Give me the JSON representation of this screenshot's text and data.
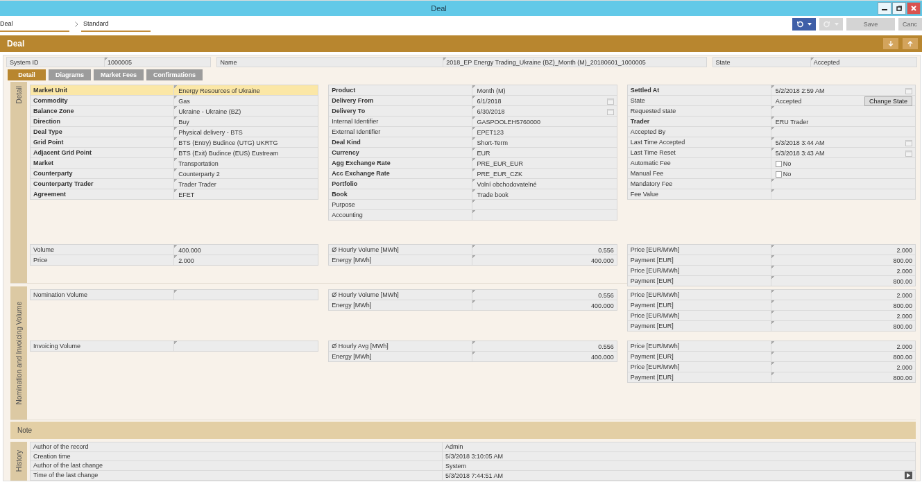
{
  "window": {
    "title": "Deal",
    "controls": [
      {
        "kind": "minimize"
      },
      {
        "kind": "restore"
      },
      {
        "kind": "close"
      }
    ]
  },
  "breadcrumb": [
    {
      "label": "Deal"
    },
    {
      "label": "Standard"
    }
  ],
  "toolbar": [
    {
      "kind": "undo",
      "disabled": false
    },
    {
      "kind": "redo",
      "disabled": true
    },
    {
      "kind": "text",
      "label": "Save",
      "disabled": true
    },
    {
      "kind": "text",
      "label": "Canc",
      "disabled": true
    }
  ],
  "header": {
    "title": "Deal",
    "buttons": [
      {
        "kind": "down"
      },
      {
        "kind": "up"
      }
    ]
  },
  "info": [
    {
      "label": "System ID",
      "value": "1000005"
    },
    {
      "label": "Name",
      "value": "2018_EP Energy Trading_Ukraine (BZ)_Month (M)_20180601_1000005"
    },
    {
      "label": "State",
      "value": "Accepted"
    }
  ],
  "tabs": [
    {
      "label": "Detail",
      "selected": true
    },
    {
      "label": "Diagrams",
      "selected": false
    },
    {
      "label": "Market Fees",
      "selected": false
    },
    {
      "label": "Confirmations",
      "selected": false
    }
  ],
  "detail": {
    "title": "Detail",
    "columns": [
      [
        {
          "label": "Market Unit",
          "value": "Energy Resources of Ukraine",
          "kind": "text",
          "bold": true,
          "selected": true
        },
        {
          "label": "Commodity",
          "value": "Gas",
          "kind": "text",
          "bold": true,
          "selected": false
        },
        {
          "label": "Balance Zone",
          "value": "Ukraine - Ukraine (BZ)",
          "kind": "text",
          "bold": true,
          "selected": false
        },
        {
          "label": "Direction",
          "value": "Buy",
          "kind": "text",
          "bold": true,
          "selected": false
        },
        {
          "label": "Deal Type",
          "value": "Physical delivery - BTS",
          "kind": "text",
          "bold": true,
          "selected": false
        },
        {
          "label": "Grid Point",
          "value": "BTS (Entry) Budince (UTG) UKRTG",
          "kind": "text",
          "bold": true,
          "selected": false
        },
        {
          "label": "Adjacent Grid Point",
          "value": "BTS (Exit) Budince (EUS) Eustream",
          "kind": "text",
          "bold": true,
          "selected": false
        },
        {
          "label": "Market",
          "value": "Transportation",
          "kind": "text",
          "bold": true,
          "selected": false
        },
        {
          "label": "Counterparty",
          "value": "Counterparty 2",
          "kind": "text",
          "bold": true,
          "selected": false
        },
        {
          "label": "Counterparty Trader",
          "value": "Trader Trader",
          "kind": "text",
          "bold": true,
          "selected": false
        },
        {
          "label": "Agreement",
          "value": "EFET",
          "kind": "text",
          "bold": true,
          "selected": false
        }
      ],
      [
        {
          "label": "Product",
          "value": "Month (M)",
          "kind": "text",
          "bold": true,
          "selected": false
        },
        {
          "label": "Delivery From",
          "value": "6/1/2018",
          "kind": "date",
          "bold": true,
          "selected": false
        },
        {
          "label": "Delivery To",
          "value": "6/30/2018",
          "kind": "date",
          "bold": true,
          "selected": false
        },
        {
          "label": "Internal Identifier",
          "value": "GASPOOLEH5760000",
          "kind": "text",
          "bold": false,
          "selected": false
        },
        {
          "label": "External Identifier",
          "value": "EPET123",
          "kind": "text",
          "bold": false,
          "selected": false
        },
        {
          "label": "Deal Kind",
          "value": "Short-Term",
          "kind": "text",
          "bold": true,
          "selected": false
        },
        {
          "label": "Currency",
          "value": "EUR",
          "kind": "text",
          "bold": true,
          "selected": false
        },
        {
          "label": "Agg Exchange Rate",
          "value": "PRE_EUR_EUR",
          "kind": "text",
          "bold": true,
          "selected": false
        },
        {
          "label": "Acc Exchange Rate",
          "value": "PRE_EUR_CZK",
          "kind": "text",
          "bold": true,
          "selected": false
        },
        {
          "label": "Portfolio",
          "value": "Volní obchodovatelné",
          "kind": "text",
          "bold": true,
          "selected": false
        },
        {
          "label": "Book",
          "value": "Trade book",
          "kind": "text",
          "bold": true,
          "selected": false
        },
        {
          "label": "Purpose",
          "kind": "text",
          "bold": false,
          "selected": false
        },
        {
          "label": "Accounting",
          "kind": "text",
          "bold": false,
          "selected": false
        }
      ],
      [
        {
          "label": "Settled At",
          "value": "5/2/2018 2:59 AM",
          "kind": "date",
          "bold": true,
          "selected": false
        },
        {
          "label": "State",
          "value": "Accepted",
          "button": "Change State",
          "kind": "state",
          "bold": false,
          "selected": false
        },
        {
          "label": "Requested state",
          "kind": "text",
          "bold": false,
          "selected": false
        },
        {
          "label": "Trader",
          "value": "ERU Trader",
          "kind": "text",
          "bold": true,
          "selected": false
        },
        {
          "label": "Accepted By",
          "kind": "text",
          "bold": false,
          "selected": false
        },
        {
          "label": "Last Time Accepted",
          "value": "5/3/2018 3:44 AM",
          "kind": "date",
          "bold": false,
          "selected": false
        },
        {
          "label": "Last Time Reset",
          "value": "5/3/2018 3:43 AM",
          "kind": "date",
          "bold": false,
          "selected": false
        },
        {
          "label": "Automatic Fee",
          "value": "No",
          "kind": "checkbox",
          "checked": false,
          "bold": false,
          "selected": false
        },
        {
          "label": "Manual Fee",
          "value": "No",
          "kind": "checkbox",
          "checked": false,
          "bold": false,
          "selected": false
        },
        {
          "label": "Mandatory Fee",
          "kind": "text",
          "bold": false,
          "selected": false
        },
        {
          "label": "Fee Value",
          "kind": "text",
          "bold": false,
          "selected": false
        }
      ]
    ],
    "amounts": [
      [
        {
          "label": "Volume",
          "value": "400.000",
          "kind": "text"
        },
        {
          "label": "Price",
          "value": "2.000",
          "kind": "text"
        }
      ],
      [
        {
          "label": "Ø Hourly Volume [MWh]",
          "value": "0.556",
          "kind": "number"
        },
        {
          "label": "Energy [MWh]",
          "value": "400.000",
          "kind": "number"
        }
      ],
      [
        {
          "label": "Price [EUR/MWh]",
          "value": "2.000",
          "kind": "number"
        },
        {
          "label": "Payment [EUR]",
          "value": "800.00",
          "kind": "number"
        },
        {
          "label": "Price [EUR/MWh]",
          "value": "2.000",
          "kind": "number"
        },
        {
          "label": "Payment [EUR]",
          "value": "800.00",
          "kind": "number"
        }
      ]
    ]
  },
  "nomination": {
    "title": "Nomination and Invoicing Volume",
    "groups": [
      [
        [
          {
            "label": "Nomination Volume",
            "kind": "text"
          }
        ],
        [
          {
            "label": "Ø Hourly Volume [MWh]",
            "value": "0.556",
            "kind": "number"
          },
          {
            "label": "Energy [MWh]",
            "value": "400.000",
            "kind": "number"
          }
        ],
        [
          {
            "label": "Price [EUR/MWh]",
            "value": "2.000",
            "kind": "number"
          },
          {
            "label": "Payment [EUR]",
            "value": "800.00",
            "kind": "number"
          },
          {
            "label": "Price [EUR/MWh]",
            "value": "2.000",
            "kind": "number"
          },
          {
            "label": "Payment [EUR]",
            "value": "800.00",
            "kind": "number"
          }
        ]
      ],
      [
        [
          {
            "label": "Invoicing Volume",
            "kind": "text"
          }
        ],
        [
          {
            "label": "Ø Hourly Avg [MWh]",
            "value": "0.556",
            "kind": "number"
          },
          {
            "label": "Energy [MWh]",
            "value": "400.000",
            "kind": "number"
          }
        ],
        [
          {
            "label": "Price [EUR/MWh]",
            "value": "2.000",
            "kind": "number"
          },
          {
            "label": "Payment [EUR]",
            "value": "800.00",
            "kind": "number"
          },
          {
            "label": "Price [EUR/MWh]",
            "value": "2.000",
            "kind": "number"
          },
          {
            "label": "Payment [EUR]",
            "value": "800.00",
            "kind": "number"
          }
        ]
      ]
    ]
  },
  "note": {
    "title": "Note"
  },
  "history": {
    "title": "History",
    "rows": [
      {
        "label": "Author of the record",
        "value": "Admin",
        "kind": "text"
      },
      {
        "label": "Creation time",
        "value": "5/3/2018 3:10:05 AM",
        "kind": "text"
      },
      {
        "label": "Author of the last change",
        "value": "System",
        "kind": "text"
      },
      {
        "label": "Time of the last change",
        "value": "5/3/2018 7:44:51 AM",
        "kind": "expand"
      }
    ]
  }
}
